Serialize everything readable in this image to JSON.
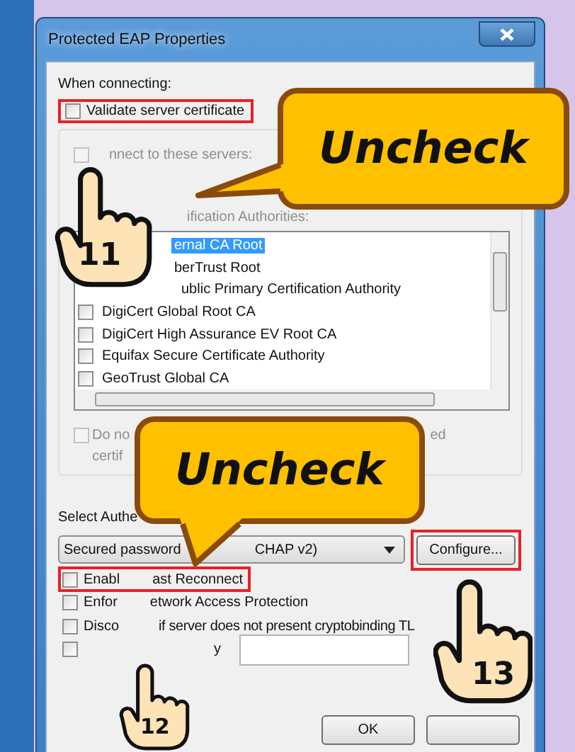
{
  "window": {
    "title": "Protected EAP Properties"
  },
  "when_connecting": {
    "label": "When connecting:",
    "validate": {
      "label": "Validate server certificate",
      "checked": false,
      "highlighted": true
    },
    "connect": {
      "label": "nnect to these servers:",
      "checked": false,
      "disabled": true
    }
  },
  "trusted": {
    "label": "ification Authorities:",
    "items": [
      {
        "label": "ernal CA Root",
        "selected": true
      },
      {
        "label": "berTrust Root",
        "selected": false
      },
      {
        "label": "ublic Primary Certification Authority",
        "selected": false
      },
      {
        "label": "DigiCert Global Root CA",
        "checked": false,
        "selected": false
      },
      {
        "label": "DigiCert High Assurance EV Root CA",
        "checked": false,
        "selected": false
      },
      {
        "label": "Equifax Secure Certificate Authority",
        "checked": false,
        "selected": false
      },
      {
        "label": "GeoTrust Global CA",
        "checked": false,
        "selected": false
      }
    ]
  },
  "do_not_prompt": {
    "parts": [
      "Do no",
      "ed"
    ],
    "second_line": "certif",
    "checked": false,
    "disabled": true
  },
  "auth": {
    "label": "Select Authe",
    "method": [
      "Secured password",
      "CHAP v2)"
    ],
    "configure": {
      "label": "Configure...",
      "highlighted": true
    }
  },
  "options": [
    {
      "kind": "plain",
      "parts": [
        "Enabl",
        "ast Reconnect"
      ],
      "checked": false,
      "highlighted": true
    },
    {
      "kind": "plain",
      "parts": [
        "Enfor",
        "etwork Access Protection"
      ],
      "checked": false,
      "highlighted": false
    },
    {
      "kind": "plain",
      "parts": [
        "Disco",
        "if server does not present cryptobinding TL"
      ],
      "checked": false,
      "highlighted": false
    },
    {
      "kind": "field",
      "parts": [
        "y"
      ],
      "checked": false,
      "highlighted": false
    }
  ],
  "buttons": [
    {
      "label": "OK"
    }
  ],
  "callouts": [
    {
      "text": "Uncheck"
    },
    {
      "text": "Uncheck"
    }
  ],
  "steps": [
    "11",
    "12",
    "13"
  ]
}
